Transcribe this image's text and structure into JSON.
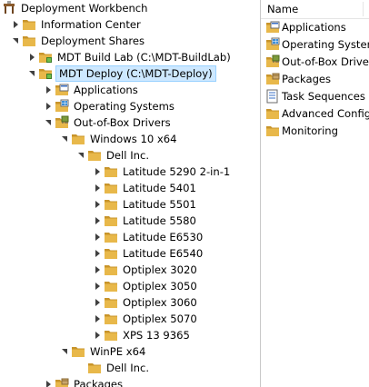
{
  "tree": [
    {
      "label": "Deployment Workbench",
      "icon": "workbench-icon",
      "toggle": "none",
      "level": 0
    },
    {
      "label": "Information Center",
      "icon": "folder-icon",
      "toggle": "collapsed",
      "level": 1
    },
    {
      "label": "Deployment Shares",
      "icon": "folder-icon",
      "toggle": "expanded",
      "level": 1
    },
    {
      "label": "MDT Build Lab (C:\\MDT-BuildLab)",
      "icon": "deployment-share-icon",
      "toggle": "collapsed",
      "level": 2
    },
    {
      "label": "MDT Deploy (C:\\MDT-Deploy)",
      "icon": "deployment-share-icon",
      "toggle": "expanded",
      "level": 2,
      "selected": true
    },
    {
      "label": "Applications",
      "icon": "applications-folder-icon",
      "toggle": "collapsed",
      "level": 3
    },
    {
      "label": "Operating Systems",
      "icon": "operating-systems-folder-icon",
      "toggle": "collapsed",
      "level": 3
    },
    {
      "label": "Out-of-Box Drivers",
      "icon": "drivers-folder-icon",
      "toggle": "expanded",
      "level": 3
    },
    {
      "label": "Windows 10 x64",
      "icon": "folder-icon",
      "toggle": "expanded",
      "level": 4
    },
    {
      "label": "Dell Inc.",
      "icon": "folder-icon",
      "toggle": "expanded",
      "level": 5
    },
    {
      "label": "Latitude 5290 2-in-1",
      "icon": "folder-icon",
      "toggle": "collapsed",
      "level": 6
    },
    {
      "label": "Latitude 5401",
      "icon": "folder-icon",
      "toggle": "collapsed",
      "level": 6
    },
    {
      "label": "Latitude 5501",
      "icon": "folder-icon",
      "toggle": "collapsed",
      "level": 6
    },
    {
      "label": "Latitude 5580",
      "icon": "folder-icon",
      "toggle": "collapsed",
      "level": 6
    },
    {
      "label": "Latitude E6530",
      "icon": "folder-icon",
      "toggle": "collapsed",
      "level": 6
    },
    {
      "label": "Latitude E6540",
      "icon": "folder-icon",
      "toggle": "collapsed",
      "level": 6
    },
    {
      "label": "Optiplex 3020",
      "icon": "folder-icon",
      "toggle": "collapsed",
      "level": 6
    },
    {
      "label": "Optiplex 3050",
      "icon": "folder-icon",
      "toggle": "collapsed",
      "level": 6
    },
    {
      "label": "Optiplex 3060",
      "icon": "folder-icon",
      "toggle": "collapsed",
      "level": 6
    },
    {
      "label": "Optiplex 5070",
      "icon": "folder-icon",
      "toggle": "collapsed",
      "level": 6
    },
    {
      "label": "XPS 13 9365",
      "icon": "folder-icon",
      "toggle": "collapsed",
      "level": 6
    },
    {
      "label": "WinPE x64",
      "icon": "folder-icon",
      "toggle": "expanded",
      "level": 4
    },
    {
      "label": "Dell Inc.",
      "icon": "folder-icon",
      "toggle": "none",
      "level": 5
    },
    {
      "label": "Packages",
      "icon": "packages-folder-icon",
      "toggle": "collapsed",
      "level": 3
    }
  ],
  "list": {
    "header": "Name",
    "items": [
      {
        "label": "Applications",
        "icon": "applications-folder-icon"
      },
      {
        "label": "Operating Systems",
        "icon": "operating-systems-folder-icon"
      },
      {
        "label": "Out-of-Box Drivers",
        "icon": "drivers-folder-icon"
      },
      {
        "label": "Packages",
        "icon": "packages-folder-icon"
      },
      {
        "label": "Task Sequences",
        "icon": "task-sequences-icon"
      },
      {
        "label": "Advanced Configuration",
        "icon": "folder-icon"
      },
      {
        "label": "Monitoring",
        "icon": "folder-icon"
      }
    ]
  },
  "colors": {
    "folder": "#e8b84a",
    "folder_dark": "#c8942a",
    "selection": "#cde8ff",
    "selection_border": "#99d1ff"
  }
}
